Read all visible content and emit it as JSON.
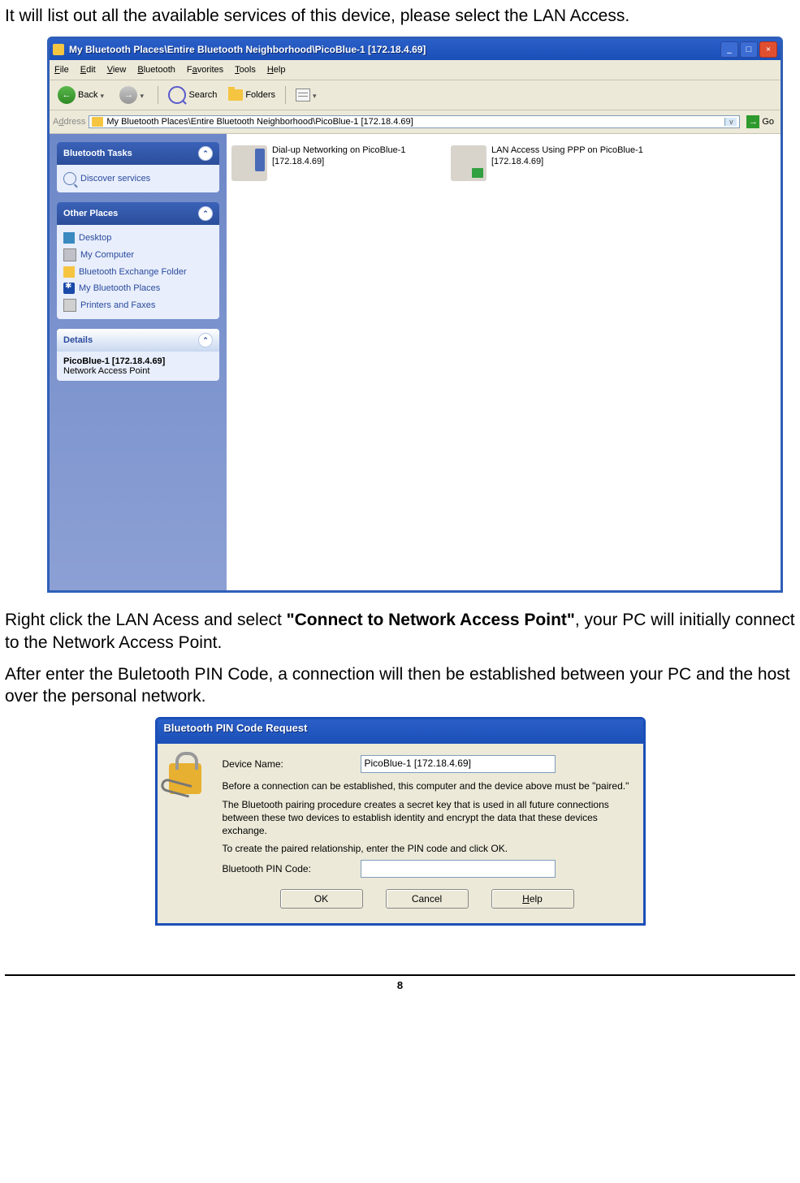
{
  "intro_text": "It will list out all the available services of this device, please select the LAN Access.",
  "win": {
    "title": "My Bluetooth Places\\Entire Bluetooth Neighborhood\\PicoBlue-1 [172.18.4.69]",
    "menus": {
      "file": "File",
      "edit": "Edit",
      "view": "View",
      "bt": "Bluetooth",
      "fav": "Favorites",
      "tools": "Tools",
      "help": "Help"
    },
    "tb": {
      "back": "Back",
      "search": "Search",
      "folders": "Folders"
    },
    "addr": {
      "label": "Address",
      "value": "My Bluetooth Places\\Entire Bluetooth Neighborhood\\PicoBlue-1 [172.18.4.69]",
      "go": "Go"
    },
    "panels": {
      "tasks": {
        "title": "Bluetooth Tasks",
        "discover": "Discover services"
      },
      "places": {
        "title": "Other Places",
        "desktop": "Desktop",
        "mycomp": "My Computer",
        "exch": "Bluetooth Exchange Folder",
        "mybt": "My Bluetooth Places",
        "prn": "Printers and Faxes"
      },
      "details": {
        "title": "Details",
        "name": "PicoBlue-1 [172.18.4.69]",
        "type": "Network Access Point"
      }
    },
    "svc": {
      "dun": "Dial-up Networking on PicoBlue-1 [172.18.4.69]",
      "lan": "LAN Access Using PPP on PicoBlue-1 [172.18.4.69]"
    }
  },
  "para2a": "Right click the LAN Acess and select ",
  "para2b": "\"Connect to Network Access Point\"",
  "para2c": ", your PC will initially connect to the Network Access Point.",
  "para3": "After enter the Buletooth PIN Code, a connection will then be established between your PC and the host over the personal network.",
  "dlg": {
    "title": "Bluetooth PIN Code Request",
    "devname_lbl": "Device Name:",
    "devname_val": "PicoBlue-1 [172.18.4.69]",
    "p1": "Before a connection can be established, this computer and the device above must be \"paired.\"",
    "p2": "The Bluetooth pairing procedure creates a secret key that is used in all future connections between these two devices to establish identity and encrypt the data that these devices exchange.",
    "p3": "To create the paired relationship, enter the PIN code and click OK.",
    "pin_lbl": "Bluetooth PIN Code:",
    "ok": "OK",
    "cancel": "Cancel",
    "help": "Help"
  },
  "pagenum": "8"
}
